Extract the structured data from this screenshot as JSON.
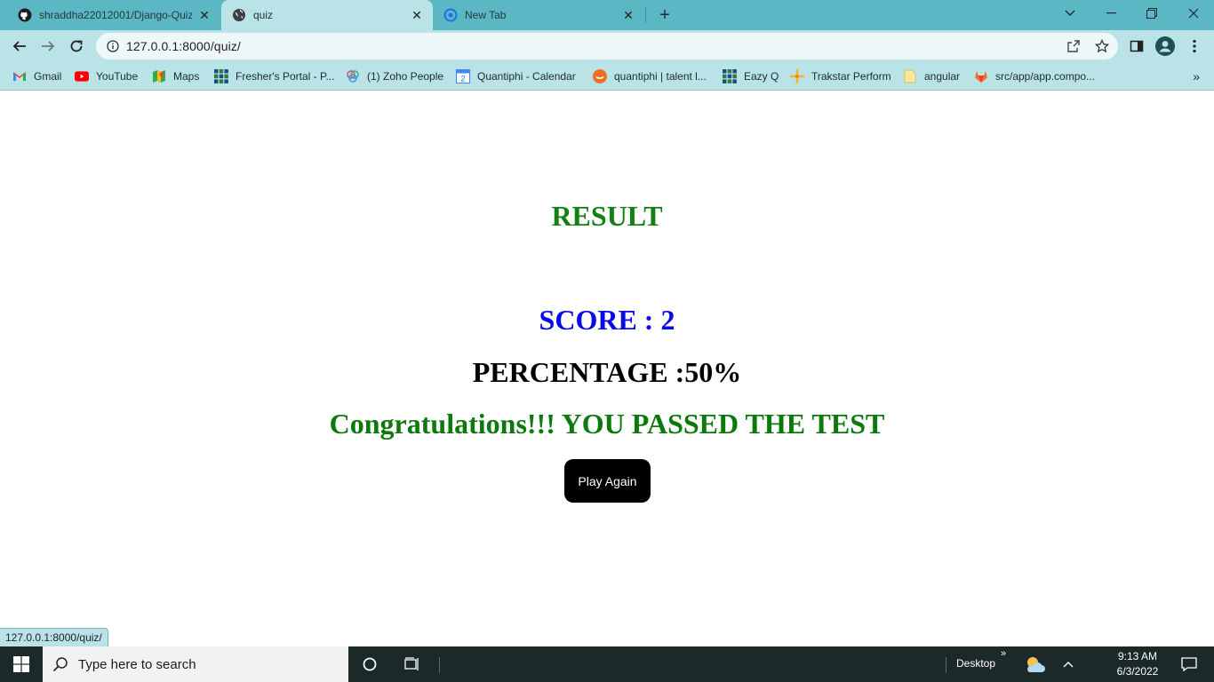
{
  "browser": {
    "tabs": [
      {
        "title": "shraddha22012001/Django-Quiz",
        "icon": "github-icon",
        "active": false
      },
      {
        "title": "quiz",
        "icon": "globe-icon",
        "active": true
      },
      {
        "title": "New Tab",
        "icon": "chrome-newtab-icon",
        "active": false
      }
    ],
    "new_tab_symbol": "+",
    "address": "127.0.0.1:8000/quiz/",
    "bookmarks": [
      {
        "label": "Gmail",
        "icon": "gmail-icon"
      },
      {
        "label": "YouTube",
        "icon": "youtube-icon"
      },
      {
        "label": "Maps",
        "icon": "maps-icon"
      },
      {
        "label": "Fresher's Portal - P...",
        "icon": "grid-icon"
      },
      {
        "label": "(1) Zoho People",
        "icon": "zoho-icon"
      },
      {
        "label": "Quantiphi - Calendar",
        "icon": "calendar-icon"
      },
      {
        "label": "quantiphi | talent l...",
        "icon": "talent-icon"
      },
      {
        "label": "Eazy Q",
        "icon": "grid-icon"
      },
      {
        "label": "Trakstar Perform",
        "icon": "trakstar-icon"
      },
      {
        "label": "angular",
        "icon": "folder-icon"
      },
      {
        "label": "src/app/app.compo...",
        "icon": "gitlab-icon"
      }
    ],
    "status_url": "127.0.0.1:8000/quiz/"
  },
  "page": {
    "heading": "RESULT",
    "score": "SCORE : 2",
    "percentage": "PERCENTAGE :50%",
    "message": "Congratulations!!! YOU PASSED THE TEST",
    "play_again_label": "Play Again"
  },
  "taskbar": {
    "search_placeholder": "Type here to search",
    "desktop_label": "Desktop",
    "time": "9:13 AM",
    "date": "6/3/2022"
  },
  "colors": {
    "tab_strip": "#5cb7c4",
    "toolbar": "#b9e3e7",
    "result_green": "#138013",
    "score_blue": "#0a0ae8",
    "message_green": "#0b7a0b",
    "taskbar": "#1b2a28"
  }
}
